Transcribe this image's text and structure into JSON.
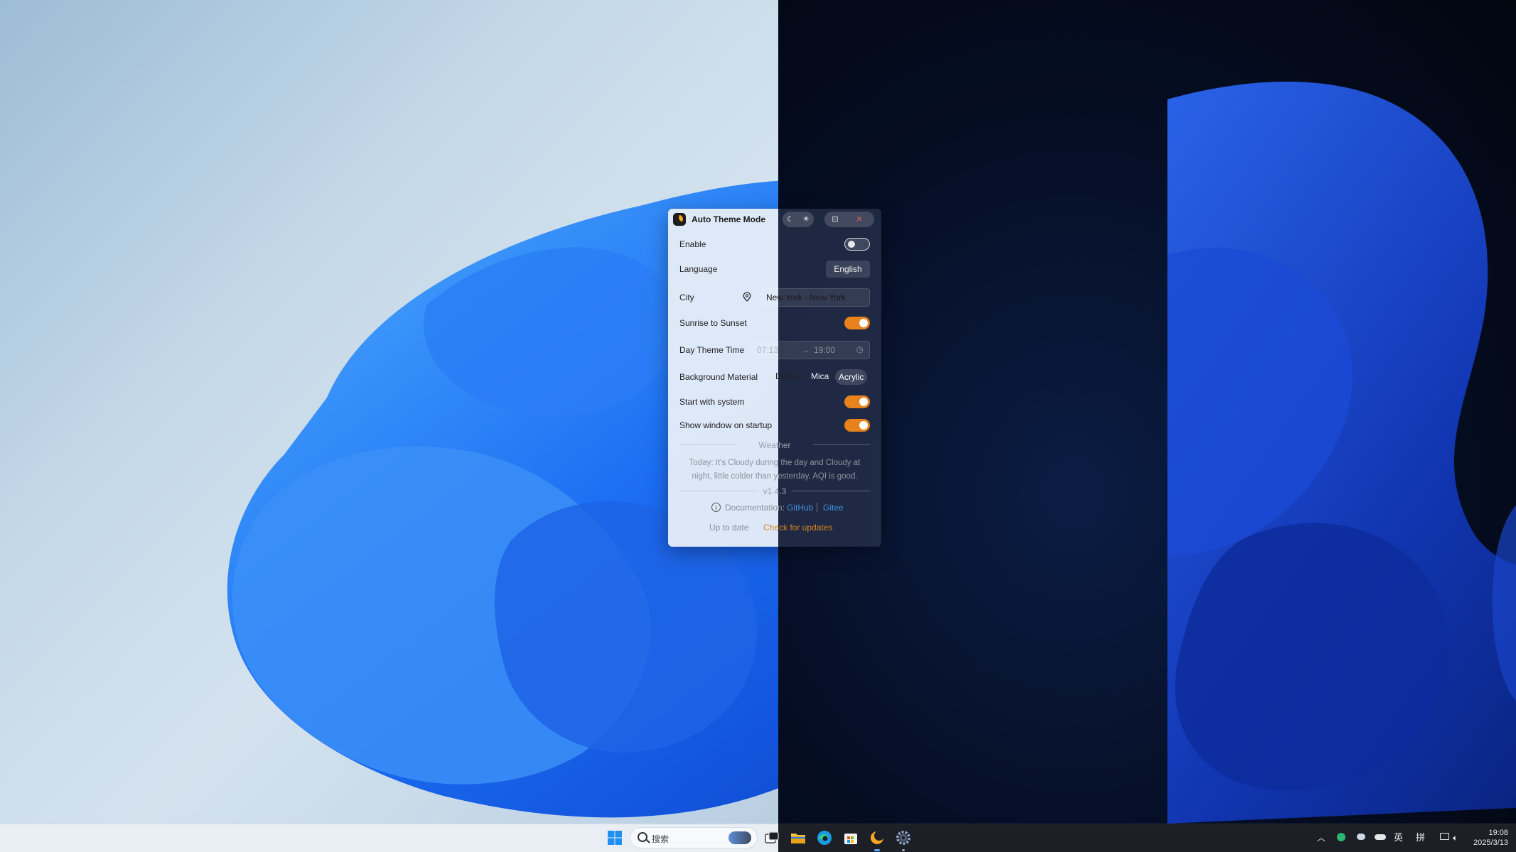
{
  "app": {
    "title": "Auto Theme Mode",
    "toolbar": {
      "moon_icon": "moon-icon",
      "sun_icon": "sun-icon",
      "pin_icon": "pin-icon",
      "close_icon": "close-icon"
    },
    "settings": {
      "enable_label": "Enable",
      "enable_on": false,
      "language_label": "Language",
      "language_value": "English",
      "city_label": "City",
      "city_value": "New York - New York",
      "sunrise_label": "Sunrise to Sunset",
      "sunrise_on": true,
      "day_theme_label": "Day Theme Time",
      "day_start": "07:13",
      "day_arrow": "→",
      "day_end": "19:00",
      "material_label": "Background Material",
      "material_options": [
        "Default",
        "Mica",
        "Acrylic"
      ],
      "material_selected": "Acrylic",
      "startup_label": "Start with system",
      "startup_on": true,
      "show_window_label": "Show window on startup",
      "show_window_on": true
    },
    "weather": {
      "heading": "Weather",
      "line1": "Today: It's Cloudy during the day and Cloudy at",
      "line2": "night, little colder than yesterday. AQI is good."
    },
    "version": "v1.4.3",
    "docs": {
      "label": "Documentation:",
      "github": "GitHub",
      "gitee": "Gitee"
    },
    "update": {
      "status": "Up to date",
      "check": "Check for updates"
    },
    "accent_color": "#e8821d"
  },
  "taskbar": {
    "search_placeholder": "搜索",
    "tray": {
      "ime_lang": "英",
      "ime_mode": "拼"
    },
    "clock": {
      "time": "19:08",
      "date": "2025/3/13"
    }
  }
}
